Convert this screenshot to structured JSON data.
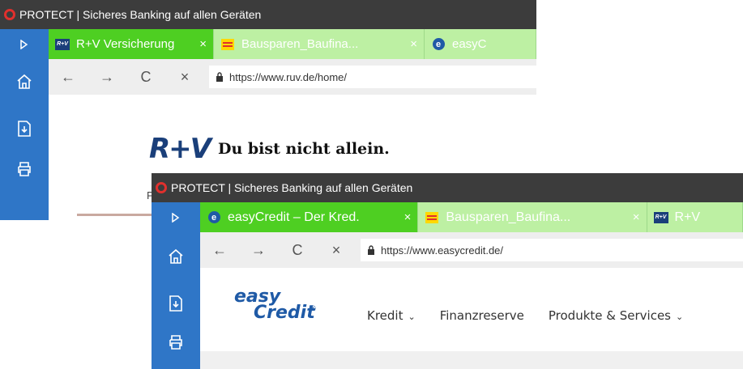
{
  "window_back": {
    "title": "PROTECT | Sicheres Banking auf allen Geräten",
    "tabs": [
      {
        "label": "R+V Versicherung",
        "close": "×"
      },
      {
        "label": "Bausparen_Baufina...",
        "close": "×"
      },
      {
        "label": "easyC",
        "close": ""
      }
    ],
    "url": "https://www.ruv.de/home/",
    "logo_mark": "R+V",
    "logo_claim": "Du bist nicht allein.",
    "partial_text": "P"
  },
  "window_front": {
    "title": "PROTECT | Sicheres Banking auf allen Geräten",
    "tabs": [
      {
        "label": "easyCredit – Der Kred.",
        "close": "×"
      },
      {
        "label": "Bausparen_Baufina...",
        "close": "×"
      },
      {
        "label": "R+V",
        "close": ""
      }
    ],
    "url": "https://www.easycredit.de/",
    "logo_line1": "easy",
    "logo_line2": "Credit",
    "logo_reg": "®",
    "nav": [
      {
        "label": "Kredit",
        "dropdown": true
      },
      {
        "label": "Finanzreserve",
        "dropdown": false
      },
      {
        "label": "Produkte & Services",
        "dropdown": true
      }
    ]
  },
  "favicon_text_ruv": "R+V",
  "nav_icons": {
    "back": "←",
    "forward": "→",
    "reload": "C",
    "stop": "×"
  },
  "colors": {
    "sidebar": "#2f76c7",
    "tab_active": "#4ecf22",
    "tab_inactive": "#bdf0a3",
    "titlebar": "#3c3c3c"
  }
}
